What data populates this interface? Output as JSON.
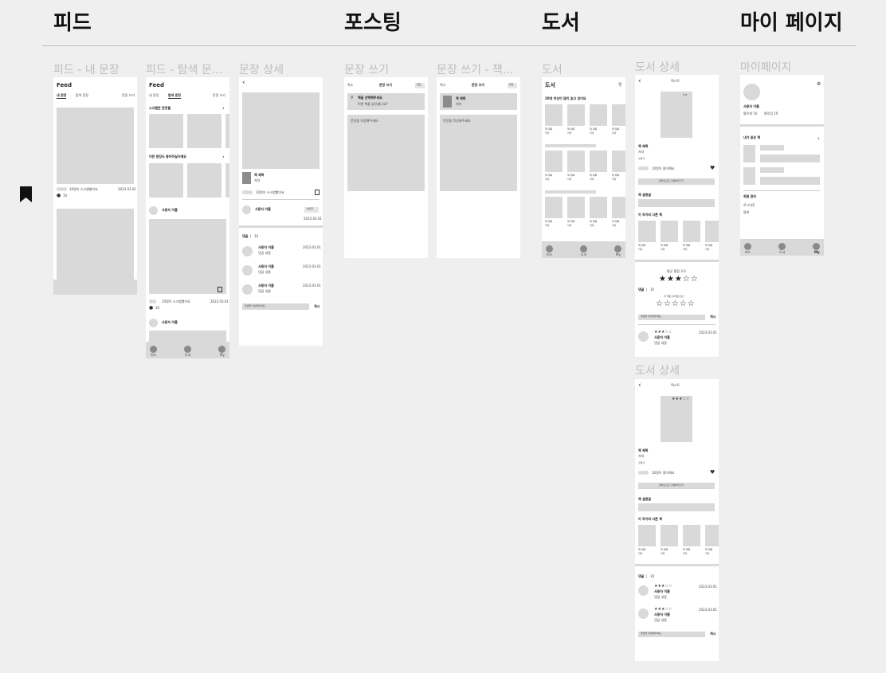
{
  "sections": {
    "feed": "피드",
    "posting": "포스팅",
    "books": "도서",
    "mypage": "마이 페이지"
  },
  "frame_titles": {
    "feed_my": "피드 - 내 문장",
    "feed_explore": "피드 - 탐색 문...",
    "sentence_detail": "문장 상세",
    "write": "문장 쓰기",
    "write_book": "문장 쓰기 - 책...",
    "books": "도서",
    "book_detail": "도서 상세",
    "book_detail2": "도서 상세",
    "mypage": "마이페이지"
  },
  "common": {
    "feed_title": "Feed",
    "tab_my": "내 문장",
    "tab_explore": "탐색 문장",
    "write_link": "문장 쓰기",
    "likes_text": "10명이 스크랩했어요",
    "likes_text_book": "10명이 좋아해요",
    "date": "2023.03.01",
    "count": "10",
    "user_name": "사용자 이름",
    "comment_body": "댓글 내용",
    "comment_label": "댓글",
    "comment_placeholder": "댓글을 작성해주세요",
    "submit": "게시",
    "follow": "팔로우",
    "book_title": "책 제목",
    "author": "저자",
    "publisher": "출판사",
    "cancel": "취소",
    "done": "완료",
    "write_title": "문장 쓰기",
    "search_book": "책을 선택해주세요",
    "search_hint": "어떤 책을 읽으셨나요?",
    "write_placeholder": "문장을 작성해주세요",
    "nav_feed": "피드",
    "nav_books": "도서",
    "nav_my": "My"
  },
  "feed_explore": {
    "scrap_title": "스크랩한 문장들",
    "recommend_title": "이런 문장도 좋아하실거예요"
  },
  "books": {
    "header": "도서",
    "banner": "20대 여성이 많이 읽고 있어요"
  },
  "book_detail": {
    "header": "텍스트",
    "buy_button": "알라딘으로 구매하러가기",
    "intro_label": "책 설명글",
    "other_books": "이 작가의 다른 책",
    "rating_label": "평균 평점 3.0",
    "rate_prompt": "이 책은 어떠셨나요?",
    "stars_avg": "★★★☆☆",
    "stars_empty": "☆☆☆☆☆",
    "stars_review": "★★★☆☆",
    "stars_small": "★★"
  },
  "mypage": {
    "follower": "팔로워 10",
    "following": "팔로잉 10",
    "read_books": "내가 읽은 책",
    "account": "회원 관리",
    "logout": "로그아웃",
    "withdraw": "탈퇴"
  },
  "icons": {
    "bookmark": "bookmark-icon",
    "back": "back-arrow-icon",
    "search": "search-icon",
    "heart": "heart-icon",
    "gear": "gear-icon"
  }
}
